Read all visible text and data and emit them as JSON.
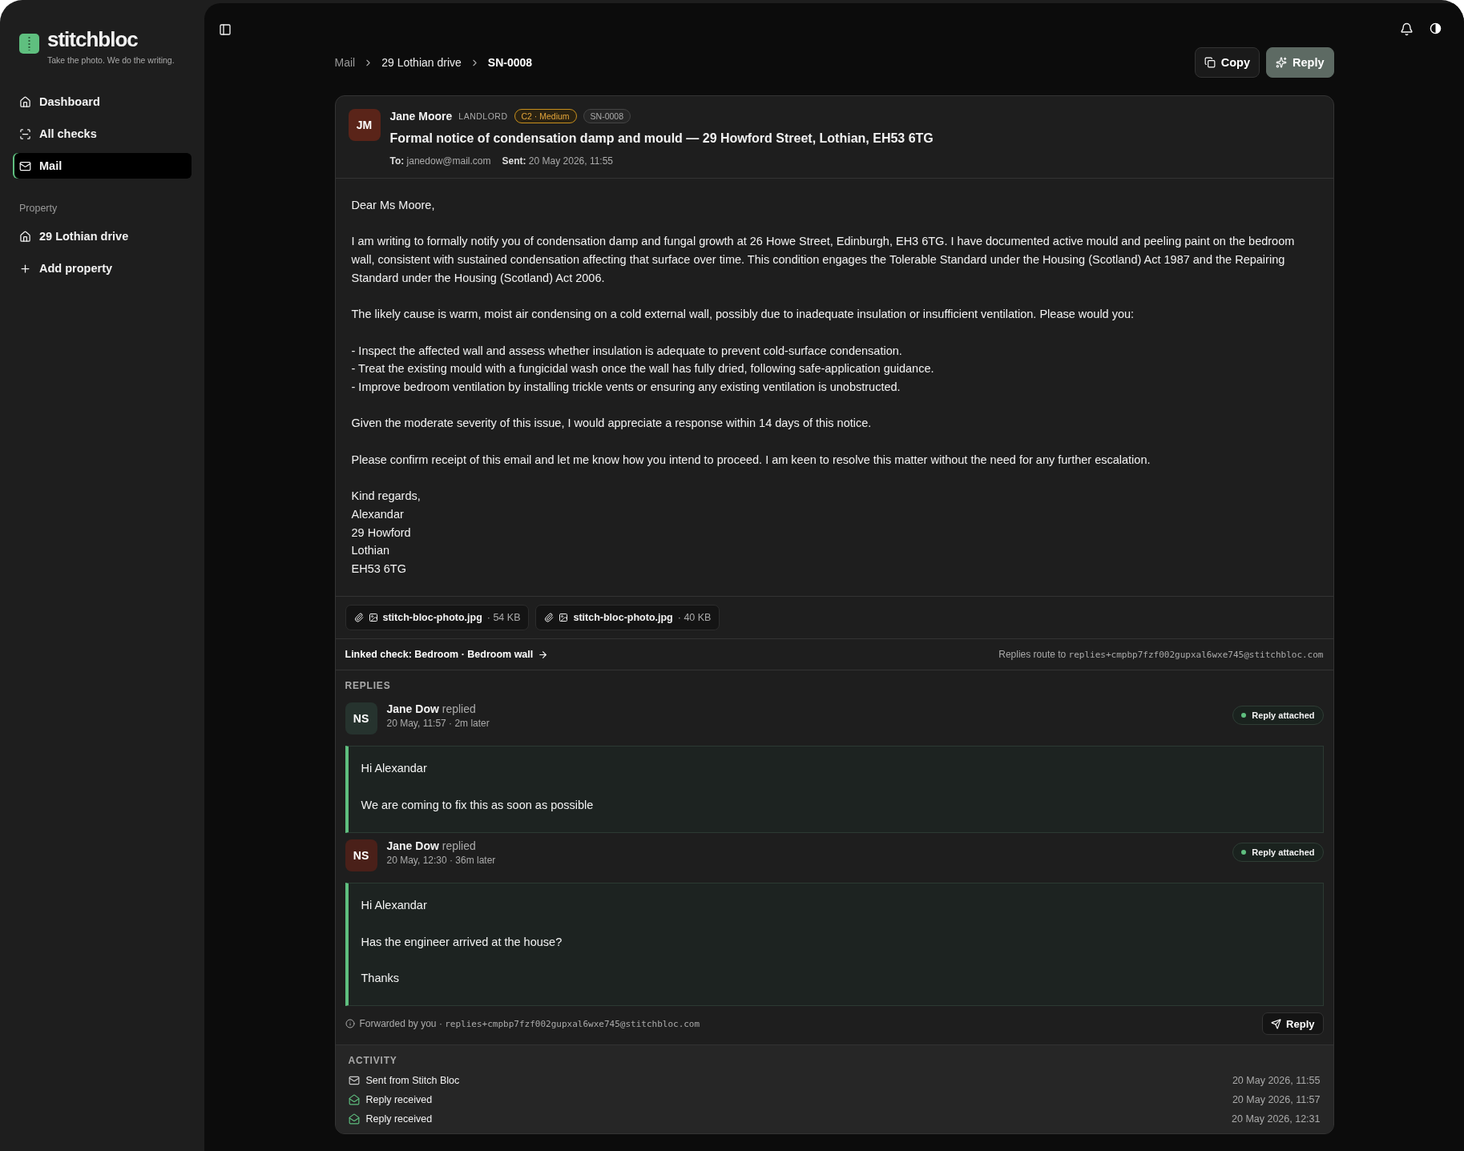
{
  "brand": {
    "name": "stitchbloc",
    "tagline": "Take the photo. We do the writing."
  },
  "sidebar": {
    "items": [
      {
        "label": "Dashboard",
        "selected": false
      },
      {
        "label": "All checks",
        "selected": false
      },
      {
        "label": "Mail",
        "selected": true
      }
    ],
    "section": "Property",
    "property_items": [
      {
        "label": "29 Lothian drive",
        "kind": "property"
      },
      {
        "label": "Add property",
        "kind": "add"
      }
    ]
  },
  "breadcrumb": [
    "Mail",
    "29 Lothian drive",
    "SN-0008"
  ],
  "actions": [
    {
      "label": "Copy",
      "kind": "secondary"
    },
    {
      "label": "Reply",
      "kind": "primary"
    }
  ],
  "email": {
    "initials": "JM",
    "sender": "Jane Moore",
    "role": "LANDLORD",
    "severity": "C2 · Medium",
    "ref": "SN-0008",
    "subject": "Formal notice of condensation damp and mould — 29 Howford Street, Lothian, EH53 6TG",
    "to_label": "To:",
    "to": "janedow@mail.com",
    "sent_label": "Sent:",
    "sent": "20 May 2026, 11:55",
    "body": [
      [
        "Dear Ms Moore,"
      ],
      [
        "I am writing to formally notify you of condensation damp and fungal growth at 26 Howe Street, Edinburgh, EH3 6TG. I have documented active mould and peeling paint on the bedroom wall, consistent with sustained condensation affecting that surface over time. This condition engages the Tolerable Standard under the Housing (Scotland) Act 1987 and the Repairing Standard under the Housing (Scotland) Act 2006."
      ],
      [
        "The likely cause is warm, moist air condensing on a cold external wall, possibly due to inadequate insulation or insufficient ventilation. Please would you:"
      ],
      [
        "- Inspect the affected wall and assess whether insulation is adequate to prevent cold-surface condensation.",
        "- Treat the existing mould with a fungicidal wash once the wall has fully dried, following safe-application guidance.",
        "- Improve bedroom ventilation by installing trickle vents or ensuring any existing ventilation is unobstructed."
      ],
      [
        "Given the moderate severity of this issue, I would appreciate a response within 14 days of this notice."
      ],
      [
        "Please confirm receipt of this email and let me know how you intend to proceed. I am keen to resolve this matter without the need for any further escalation."
      ],
      [
        "Kind regards,",
        "Alexandar",
        "29 Howford",
        "Lothian",
        "EH53 6TG"
      ]
    ],
    "attachments": [
      {
        "name": "stitch-bloc-photo.jpg",
        "size": "· 54 KB"
      },
      {
        "name": "stitch-bloc-photo.jpg",
        "size": "· 40 KB"
      }
    ],
    "linked_check": "Linked check: Bedroom · Bedroom wall",
    "route_label": "Replies route to",
    "route_address": "replies+cmpbp7fzf002gupxal6wxe745@stitchbloc.com"
  },
  "replies_heading": "REPLIES",
  "replies": [
    {
      "initials": "NS",
      "color": "#26332e",
      "name": "Jane Dow",
      "verb": "replied",
      "time": "20 May, 11:57 · 2m later",
      "status": "Reply attached",
      "message": [
        "Hi Alexandar",
        "We are coming to fix this as soon as possible"
      ]
    },
    {
      "initials": "NS",
      "color": "#4a2019",
      "name": "Jane Dow",
      "verb": "replied",
      "time": "20 May, 12:30 · 36m later",
      "status": "Reply attached",
      "message": [
        "Hi Alexandar",
        "Has the engineer arrived at the house?",
        "Thanks"
      ]
    }
  ],
  "forwarded": {
    "label": "Forwarded by you ·",
    "address": "replies+cmpbp7fzf002gupxal6wxe745@stitchbloc.com",
    "button": "Reply"
  },
  "activity": {
    "heading": "ACTIVITY",
    "rows": [
      {
        "kind": "sent",
        "label": "Sent from Stitch Bloc",
        "time": "20 May 2026, 11:55"
      },
      {
        "kind": "received",
        "label": "Reply received",
        "time": "20 May 2026, 11:57"
      },
      {
        "kind": "received",
        "label": "Reply received",
        "time": "20 May 2026, 12:31"
      }
    ]
  }
}
